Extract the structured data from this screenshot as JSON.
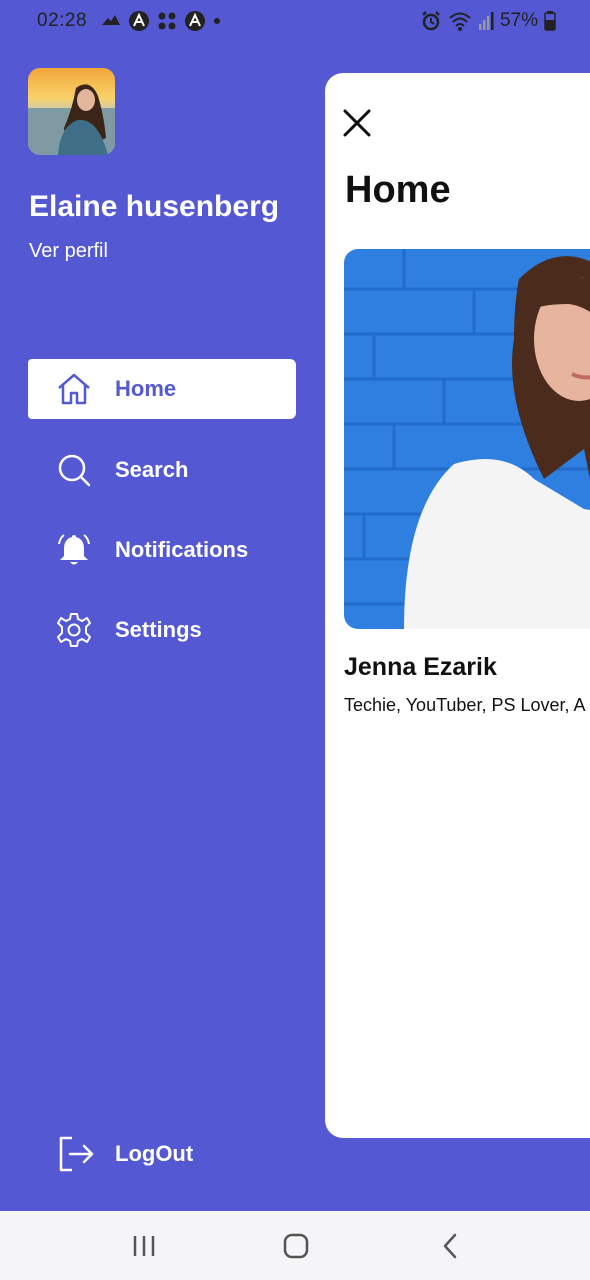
{
  "status_bar": {
    "time": "02:28",
    "battery": "57%",
    "left_icons": [
      "cloud-icon",
      "app-icon",
      "grid-icon",
      "app-icon",
      "dot-icon"
    ],
    "right_icons": [
      "alarm-icon",
      "wifi-icon",
      "signal-icon",
      "battery-icon"
    ]
  },
  "profile": {
    "name": "Elaine husenberg",
    "link": "Ver perfil"
  },
  "menu": {
    "items": [
      {
        "label": "Home",
        "icon": "home-icon",
        "active": true
      },
      {
        "label": "Search",
        "icon": "search-icon",
        "active": false
      },
      {
        "label": "Notifications",
        "icon": "bell-icon",
        "active": false
      },
      {
        "label": "Settings",
        "icon": "gear-icon",
        "active": false
      }
    ],
    "logout": "LogOut"
  },
  "panel": {
    "title": "Home",
    "card": {
      "name": "Jenna Ezarik",
      "bio": "Techie, YouTuber, PS Lover, A"
    }
  },
  "colors": {
    "accent": "#5458d2",
    "panel_bg": "#ffffff",
    "nav_bg": "#f5f5f7"
  },
  "nav_bar": {
    "buttons": [
      "recents-icon",
      "home-circle-icon",
      "back-icon"
    ]
  }
}
